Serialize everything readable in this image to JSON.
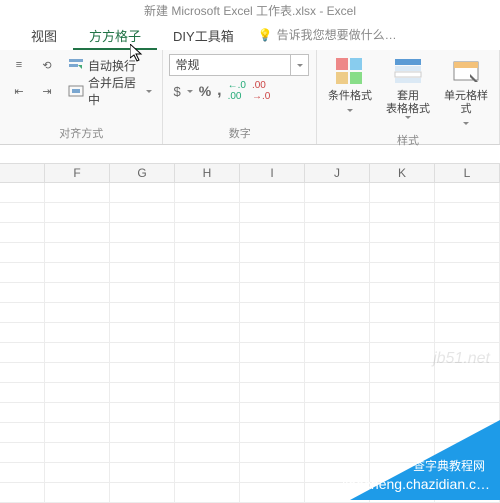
{
  "title": "新建 Microsoft Excel 工作表.xlsx - Excel",
  "tabs": {
    "view": "视图",
    "fgz": "方方格子",
    "diy": "DIY工具箱"
  },
  "tellme": "告诉我您想要做什么…",
  "align": {
    "wrap": "自动换行",
    "merge": "合并后居中",
    "label": "对齐方式"
  },
  "number": {
    "format": "常规",
    "pct": "%",
    "comma": ",",
    "dec_inc": ".00→.0",
    "dec_dec": ".0→.00",
    "label": "数字",
    "curr": "$"
  },
  "styles": {
    "cond": "条件格式",
    "table": "套用\n表格格式",
    "cell": "单元格样式",
    "label": "样式"
  },
  "cols": [
    "F",
    "G",
    "H",
    "I",
    "J",
    "K",
    "L"
  ],
  "rows": 16,
  "watermark": {
    "url": "jb51.net",
    "corner": "查字典教程网",
    "sub": "jiaocheng.chazidian.c…"
  }
}
